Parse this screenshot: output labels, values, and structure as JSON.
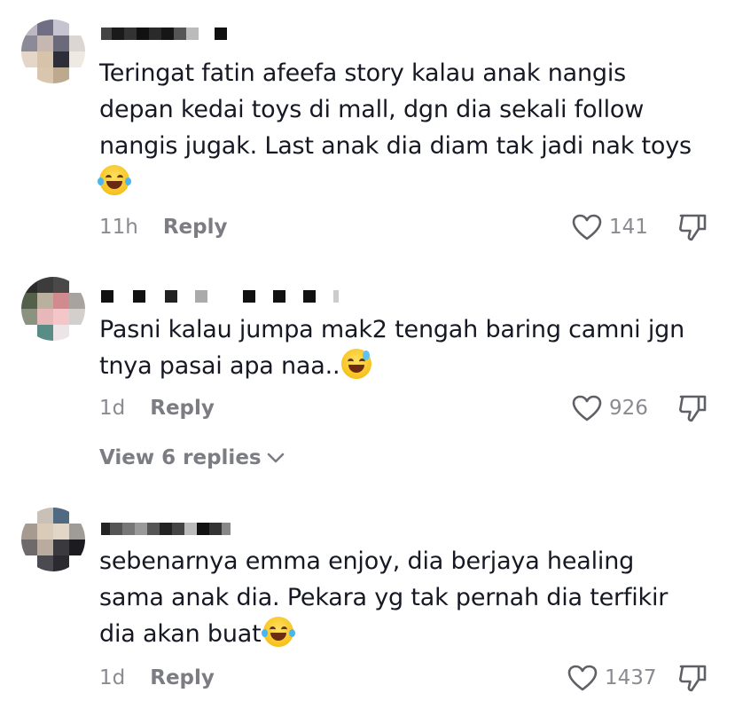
{
  "comments": [
    {
      "text": "Teringat fatin afeefa story kalau anak nangis\ndepan kedai toys di mall, dgn dia sekali follow\nnangis jugak. Last anak dia diam tak jadi nak toys",
      "emoji": "face-with-tears-of-joy",
      "time": "11h",
      "reply_label": "Reply",
      "likes": "141"
    },
    {
      "text": "Pasni kalau jumpa mak2 tengah baring camni jgn\ntnya pasai apa naa..",
      "emoji": "grinning-face-with-sweat",
      "time": "1d",
      "reply_label": "Reply",
      "likes": "926",
      "view_replies": "View 6 replies"
    },
    {
      "text": "sebenarnya emma enjoy, dia berjaya healing\nsama anak dia. Pekara yg tak pernah dia terfikir\ndia akan buat",
      "emoji": "face-with-tears-of-joy",
      "time": "1d",
      "reply_label": "Reply",
      "likes": "1437"
    }
  ],
  "colors": {
    "text": "#161823",
    "meta": "#8a8b91",
    "icon": "#5f6066"
  }
}
